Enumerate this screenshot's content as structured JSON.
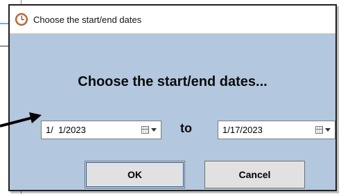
{
  "dialog": {
    "title": "Choose the start/end dates",
    "heading": "Choose the start/end dates...",
    "start_date": "1/  1/2023",
    "end_date": "1/17/2023",
    "to_label": "to",
    "ok_label": "OK",
    "cancel_label": "Cancel"
  },
  "colors": {
    "dialog_bg": "#b3c7de",
    "titlebar_bg": "#ffffff",
    "button_bg": "#e1e1e1",
    "focus_outline": "#0b57c0"
  }
}
